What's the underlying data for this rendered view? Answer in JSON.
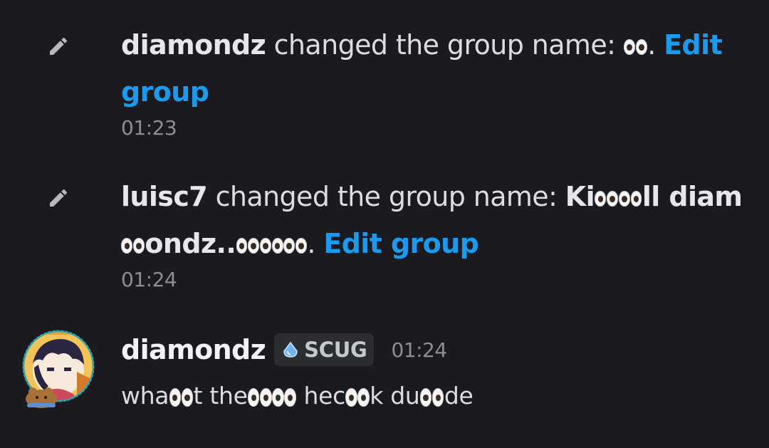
{
  "events": [
    {
      "user": "diamondz",
      "action": " changed the group name: ",
      "link": "Edit group",
      "time": "01:23"
    },
    {
      "user": "luisc7",
      "action": " changed the group name: ",
      "name_text_1": "Ki",
      "name_text_2": "ll",
      "name_text_3": "diam",
      "name_text_4": "ondz..",
      "link": "Edit group",
      "time": "01:24"
    }
  ],
  "message": {
    "user": "diamondz",
    "tag": "SCUG",
    "time": "01:24",
    "parts": [
      "wha",
      "t the",
      " hec",
      "k du",
      "de"
    ]
  },
  "icons": {
    "system_event": "pencil-icon",
    "emoji": "eyes-emoji",
    "tag_badge": "droplet-icon"
  },
  "colors": {
    "background": "#1b1b1f",
    "link": "#1a9bf0",
    "timestamp": "#8b8e95",
    "tag_bg": "#2b2d31"
  }
}
